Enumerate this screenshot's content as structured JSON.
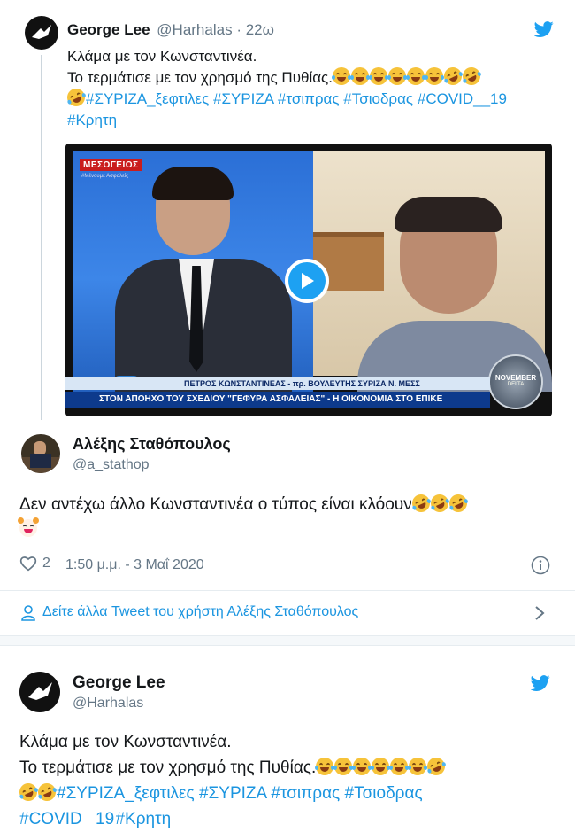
{
  "colors": {
    "accent": "#1da1f2",
    "link": "#1b95e0",
    "muted": "#657786",
    "divider": "#e6ecf0"
  },
  "quoted_tweet": {
    "name": "George Lee",
    "handle": "@Harhalas",
    "time": "· 22ω",
    "text_line1": "Κλάμα με τον Κωνσταντινέα.",
    "text_line2": "Το τερμάτισε με τον χρησμό της Πυθίας.",
    "hashtags": [
      "#ΣΥΡΙΖΑ_ξεφτιλες",
      "#ΣΥΡΙΖΑ",
      "#τσιπρας",
      "#Τσιοδρας",
      "#COVID__19",
      "#Κρητη"
    ],
    "video": {
      "channel": "ΜΕΣΟΓΕΙΟΣ",
      "channel_sub": "#Μένουμε Ασφαλείς",
      "lower_third_name": "ΠΕΤΡΟΣ ΚΩΝΣΤΑΝΤΙΝΕΑΣ - πρ. ΒΟΥΛΕΥΤΗΣ ΣΥΡΙΖΑ Ν. ΜΕΣΣ",
      "ticker": "ΣΤΟΝ ΑΠΟΗΧΟ ΤΟΥ ΣΧΕΔΙΟΥ \"ΓΕΦΥΡΑ ΑΣΦΑΛΕΙΑΣ\" - Η ΟΙΚΟΝΟΜΙΑ ΣΤΟ ΕΠΙΚΕ",
      "badge": "NOVEMBER",
      "badge_sub": "DELTA"
    }
  },
  "reply_tweet": {
    "name": "Αλέξης Σταθόπουλος",
    "handle": "@a_stathop",
    "text": "Δεν αντέχω άλλο Κωνσταντινέα ο τύπος είναι κλόουν",
    "likes": "2",
    "timestamp": "1:50 μ.μ. - 3 Μαΐ 2020"
  },
  "more_link": {
    "label": "Δείτε άλλα Tweet του χρήστη Αλέξης Σταθόπουλος"
  },
  "bottom_tweet": {
    "name": "George Lee",
    "handle": "@Harhalas",
    "text_line1": "Κλάμα με τον Κωνσταντινέα.",
    "text_line2": "Το τερμάτισε με τον χρησμό της Πυθίας.",
    "hashtags_line3": [
      "#ΣΥΡΙΖΑ_ξεφτιλες",
      "#ΣΥΡΙΖΑ",
      "#τσιπρας",
      "#Τσιοδρας"
    ],
    "hashtags_line4": [
      "#COVID",
      "19",
      "#Κρητη"
    ]
  }
}
